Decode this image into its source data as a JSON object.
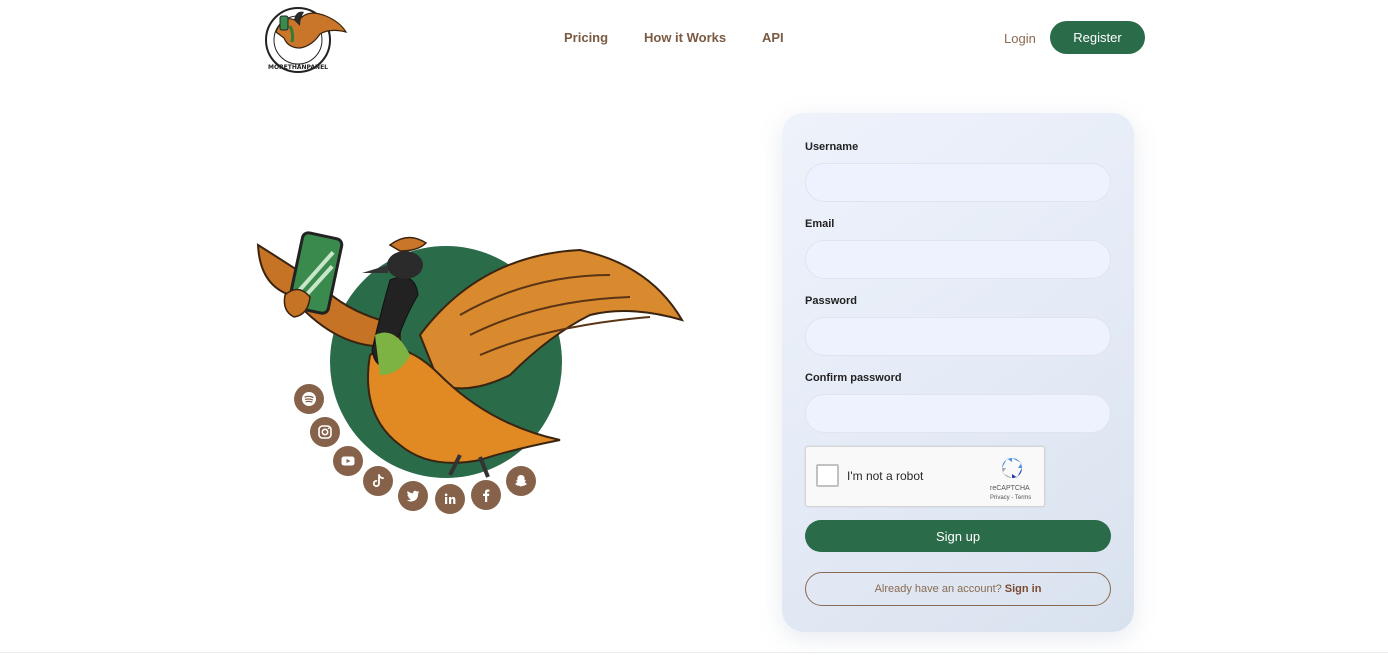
{
  "brand": {
    "name": "MORETHANPANEL"
  },
  "nav": {
    "pricing": "Pricing",
    "how_it_works": "How it Works",
    "api": "API"
  },
  "header": {
    "login": "Login",
    "register": "Register"
  },
  "social_icons": [
    "spotify-icon",
    "instagram-icon",
    "youtube-icon",
    "tiktok-icon",
    "twitter-icon",
    "linkedin-icon",
    "facebook-icon",
    "snapchat-icon"
  ],
  "form": {
    "username_label": "Username",
    "email_label": "Email",
    "password_label": "Password",
    "confirm_label": "Confirm password",
    "username_value": "",
    "email_value": "",
    "password_value": "",
    "confirm_value": "",
    "captcha_text": "I'm not a robot",
    "captcha_brand": "reCAPTCHA",
    "captcha_links": "Privacy - Terms",
    "signup_button": "Sign up",
    "signin_prompt": "Already have an account?",
    "signin_link": "Sign in"
  },
  "colors": {
    "brand_green": "#2a6b4a",
    "brand_brown": "#86624a",
    "card_bg": "#eef2fb"
  }
}
